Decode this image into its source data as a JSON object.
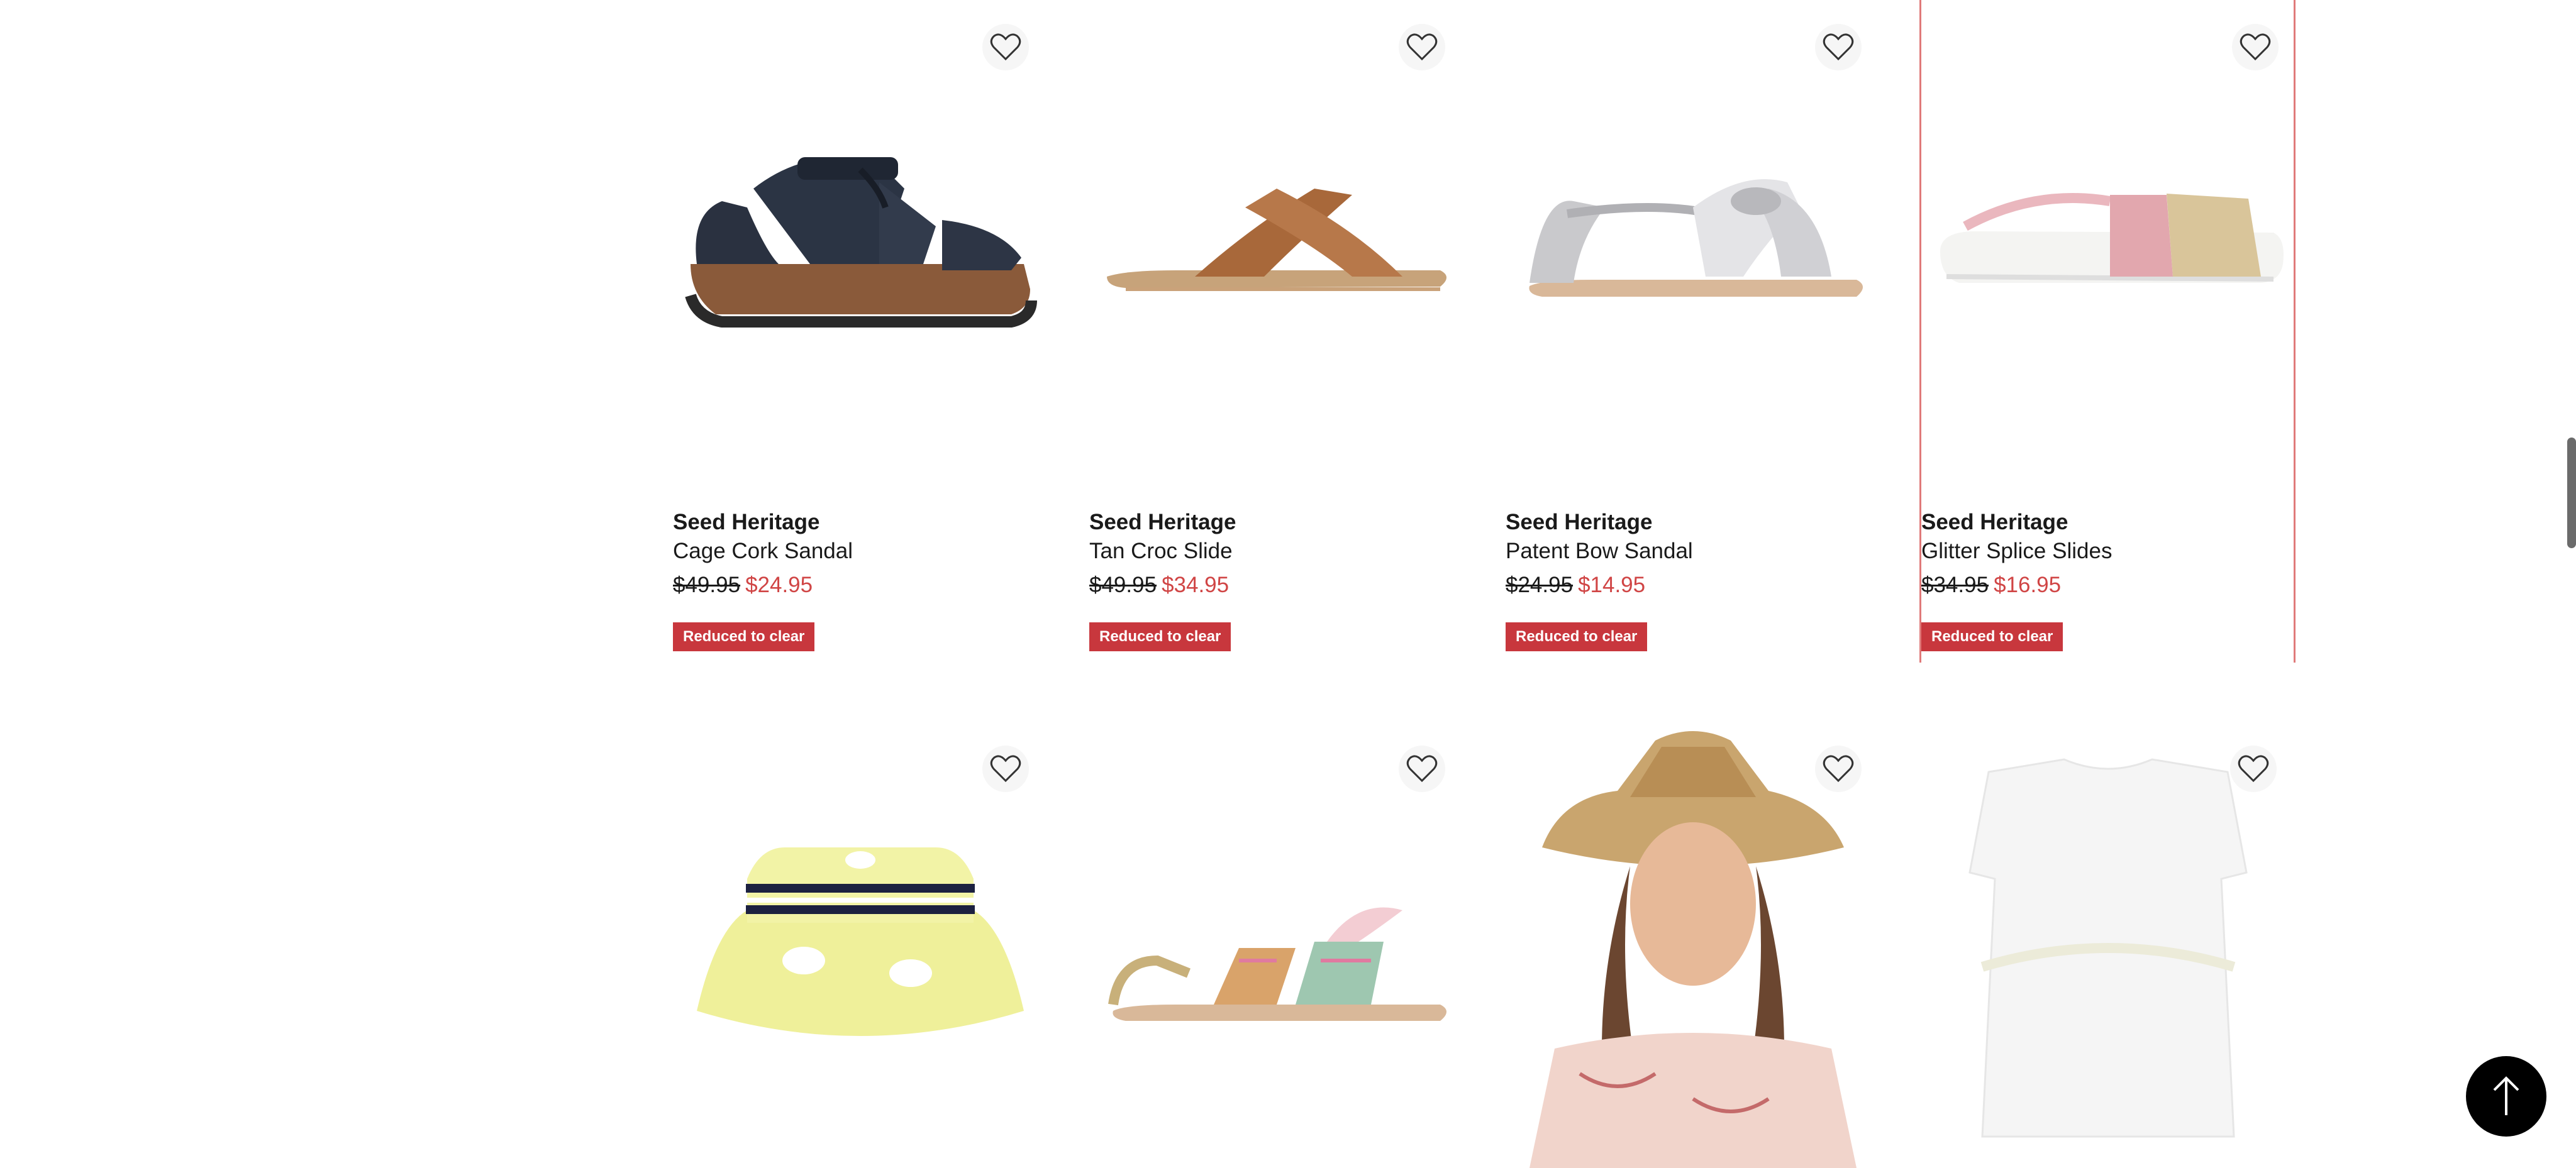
{
  "products_row1": [
    {
      "brand": "Seed Heritage",
      "name": "Cage Cork Sandal",
      "was": "$49.95",
      "now": "$24.95",
      "badge": "Reduced to clear"
    },
    {
      "brand": "Seed Heritage",
      "name": "Tan Croc Slide",
      "was": "$49.95",
      "now": "$34.95",
      "badge": "Reduced to clear"
    },
    {
      "brand": "Seed Heritage",
      "name": "Patent Bow Sandal",
      "was": "$24.95",
      "now": "$14.95",
      "badge": "Reduced to clear"
    },
    {
      "brand": "Seed Heritage",
      "name": "Glitter Splice Slides",
      "was": "$34.95",
      "now": "$16.95",
      "badge": "Reduced to clear"
    }
  ],
  "icons": {
    "wishlist": "heart-outline-icon",
    "back_to_top": "arrow-up-icon"
  },
  "colors": {
    "sale_price": "#d04545",
    "badge_bg": "#c8373d",
    "badge_text": "#ffffff",
    "highlight_border": "#e07a7a"
  }
}
